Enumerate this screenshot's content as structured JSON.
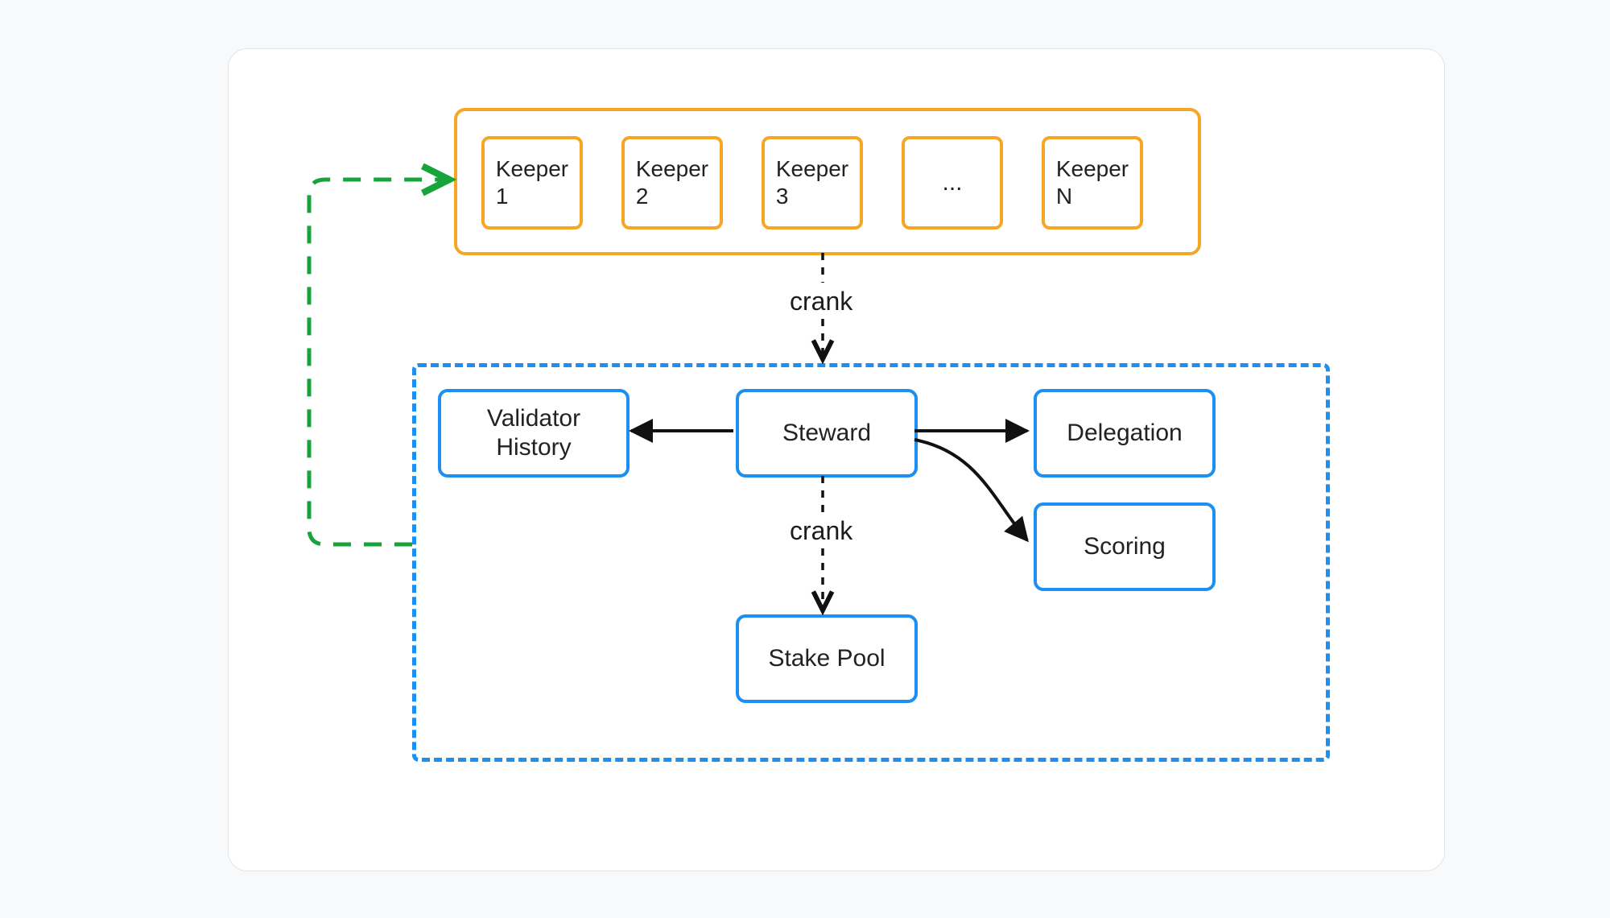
{
  "keepers": {
    "items": [
      "Keeper 1",
      "Keeper 2",
      "Keeper 3",
      "...",
      "Keeper N"
    ]
  },
  "labels": {
    "crank1": "crank",
    "crank2": "crank"
  },
  "nodes": {
    "validatorHistory": "Validator History",
    "steward": "Steward",
    "delegation": "Delegation",
    "scoring": "Scoring",
    "stakePool": "Stake Pool"
  }
}
